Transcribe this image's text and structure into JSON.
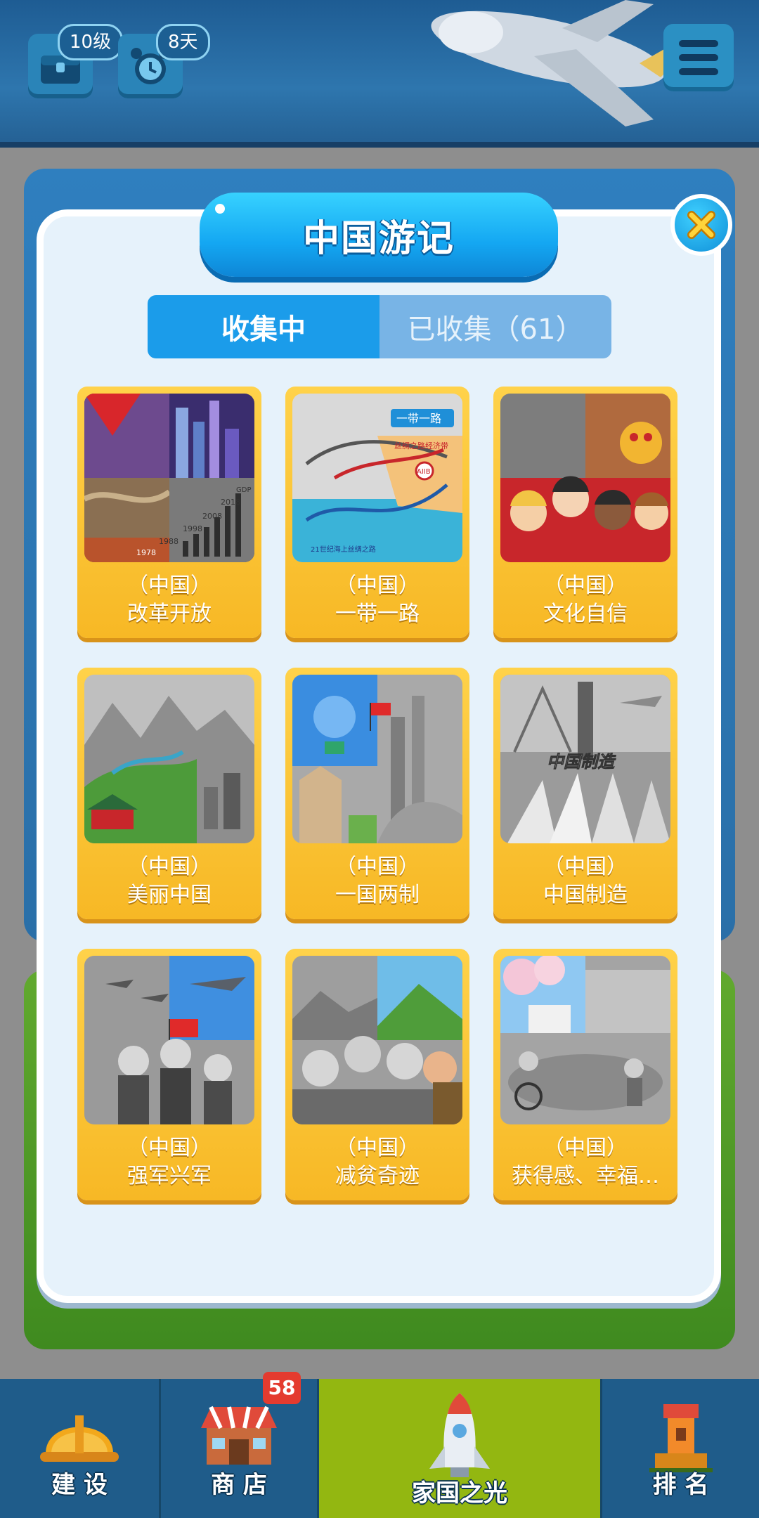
{
  "hud": {
    "level_badge": "10级",
    "days_badge": "8天"
  },
  "modal": {
    "title": "中国游记",
    "tabs": [
      {
        "label": "收集中",
        "active": true
      },
      {
        "label": "已收集（61）",
        "active": false
      }
    ],
    "cards": [
      {
        "tag": "（中国）",
        "name": "改革开放",
        "image": "reform-opening-skyline"
      },
      {
        "tag": "（中国）",
        "name": "一带一路",
        "image": "belt-and-road-map"
      },
      {
        "tag": "（中国）",
        "name": "文化自信",
        "image": "culture-characters"
      },
      {
        "tag": "（中国）",
        "name": "美丽中国",
        "image": "beautiful-landscape"
      },
      {
        "tag": "（中国）",
        "name": "一国两制",
        "image": "flags-architecture"
      },
      {
        "tag": "（中国）",
        "name": "中国制造",
        "image": "trains-bridge"
      },
      {
        "tag": "（中国）",
        "name": "强军兴军",
        "image": "military-soldiers"
      },
      {
        "tag": "（中国）",
        "name": "减贫奇迹",
        "image": "village-people"
      },
      {
        "tag": "（中国）",
        "name": "获得感、幸福…",
        "image": "park-wheelchair"
      }
    ],
    "picture_texts": {
      "years": [
        "1978",
        "1988",
        "1998",
        "2008",
        "2018",
        "GDP"
      ],
      "road_banner": "一带一路",
      "silk_road": "丝绸之路经济带",
      "sea_route": "21世纪海上丝绸之路",
      "aiib": "AIIB",
      "made_in_china": "中国制造"
    }
  },
  "nav": {
    "items": [
      {
        "label": "建 设",
        "icon": "hard-hat-icon"
      },
      {
        "label": "商 店",
        "icon": "shop-icon",
        "badge": "58"
      },
      {
        "label": "家国之光",
        "icon": "rocket-icon",
        "active": true
      },
      {
        "label": "排 名",
        "icon": "ranking-tower-icon"
      }
    ]
  },
  "colors": {
    "accent": "#1b9cea",
    "card": "#f7b825",
    "nav_active": "#93b711",
    "badge": "#e43b2f"
  }
}
